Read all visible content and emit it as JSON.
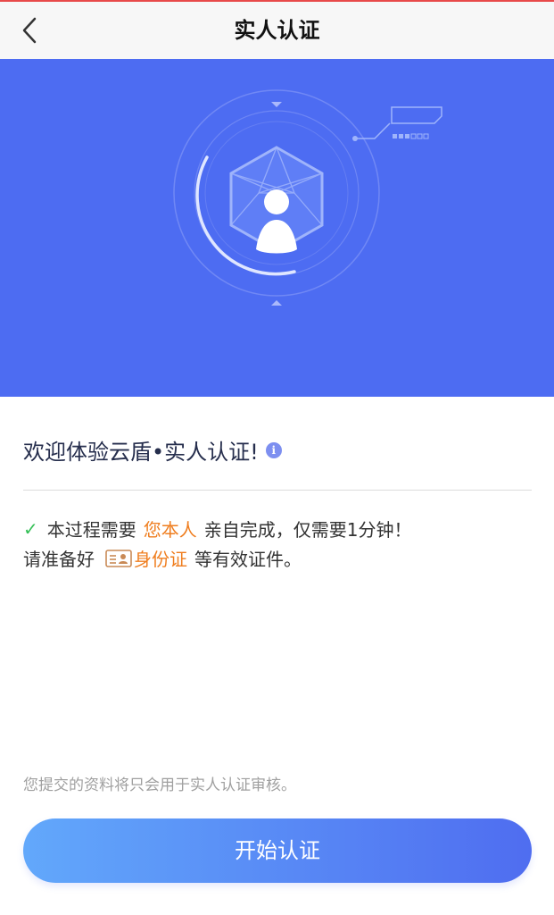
{
  "nav": {
    "title": "实人认证"
  },
  "welcome": {
    "text": "欢迎体验云盾•实人认证!"
  },
  "requirement": {
    "prefix": "本过程需要",
    "highlight": "您本人",
    "suffix": "亲自完成，仅需要1分钟！",
    "line2_prefix": "请准备好",
    "id_label": "身份证",
    "line2_suffix": "等有效证件。"
  },
  "notice": "您提交的资料将只会用于实人认证审核。",
  "start_button": "开始认证",
  "colors": {
    "banner": "#4d6cf2",
    "accent_orange": "#ef7d1e",
    "check_green": "#35c057",
    "button_gradient_start": "#62a8fb",
    "button_gradient_end": "#4f6df0"
  },
  "icons": {
    "back": "chevron-left-icon",
    "info": "info-icon",
    "check": "check-icon",
    "id_card": "id-card-icon",
    "illustration": "face-verification-illustration"
  }
}
